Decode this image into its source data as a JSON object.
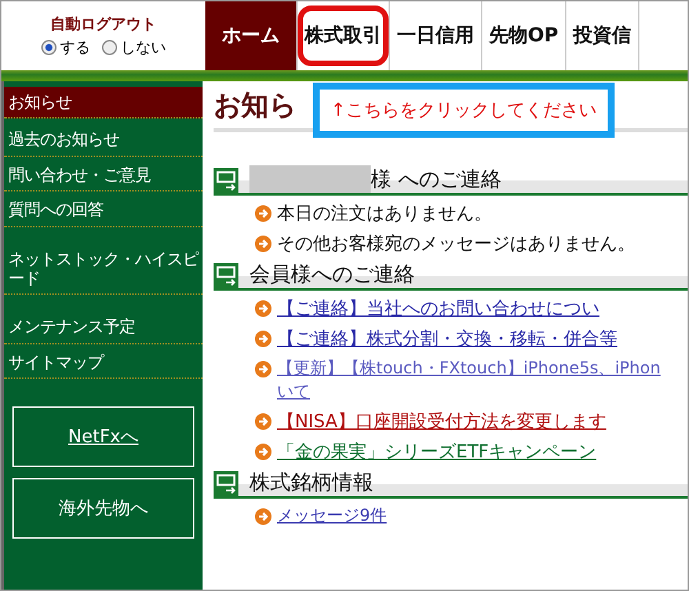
{
  "auto_logout": {
    "title": "自動ログアウト",
    "options": [
      {
        "label": "する",
        "selected": true
      },
      {
        "label": "しない",
        "selected": false
      }
    ]
  },
  "tabs": [
    {
      "label": "ホーム",
      "selected": true,
      "highlighted": false
    },
    {
      "label": "株式取引",
      "selected": false,
      "highlighted": true
    },
    {
      "label": "一日信用",
      "selected": false,
      "highlighted": false
    },
    {
      "label": "先物OP",
      "selected": false,
      "highlighted": false
    },
    {
      "label": "投資信",
      "selected": false,
      "highlighted": false
    }
  ],
  "sidebar": {
    "items": [
      {
        "label": "お知らせ",
        "selected": true
      },
      {
        "label": "過去のお知らせ",
        "selected": false
      },
      {
        "label": "問い合わせ・ご意見",
        "selected": false
      },
      {
        "label": "質問への回答",
        "selected": false
      },
      {
        "label": "ネットストック・ハイスピード",
        "selected": false
      },
      {
        "label": "メンテナンス予定",
        "selected": false
      },
      {
        "label": "サイトマップ",
        "selected": false
      }
    ],
    "buttons": [
      {
        "label": "NetFxへ",
        "kind": "link"
      },
      {
        "label": "海外先物へ",
        "kind": "plain"
      }
    ]
  },
  "page_title": "お知ら",
  "callout": "↑こちらをクリックしてください",
  "sections": [
    {
      "heading": "様 へのご連絡",
      "redacted_name": true,
      "items": [
        {
          "kind": "text",
          "text": "本日の注文はありません。"
        },
        {
          "kind": "text",
          "text": "その他お客様宛のメッセージはありません。"
        }
      ]
    },
    {
      "heading": "会員様へのご連絡",
      "redacted_name": false,
      "items": [
        {
          "kind": "link",
          "text": "【ご連絡】当社へのお問い合わせについ",
          "color": "#2a2aa8"
        },
        {
          "kind": "link",
          "text": "【ご連絡】株式分割・交換・移転・併合等",
          "color": "#2a2aa8"
        },
        {
          "kind": "small_link",
          "text": "【更新】【株touch・FXtouch】iPhone5s、iPhon",
          "continuation": "いて",
          "color": "#5a5ac0"
        },
        {
          "kind": "link",
          "text": "【NISA】口座開設受付方法を変更します",
          "color": "#b01010"
        },
        {
          "kind": "link",
          "text": "「金の果実」シリーズETFキャンペーン",
          "color": "#107030"
        }
      ]
    },
    {
      "heading": "株式銘柄情報",
      "redacted_name": false,
      "items": [
        {
          "kind": "small_link",
          "text": "メッセージ9件",
          "color": "#3a3ab0"
        }
      ]
    }
  ]
}
